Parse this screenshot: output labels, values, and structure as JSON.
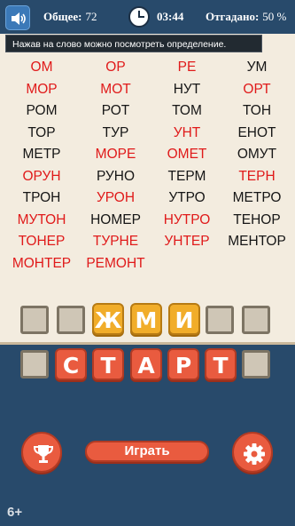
{
  "header": {
    "total_label": "Общее:",
    "total_value": "72",
    "timer": "03:44",
    "guessed_label": "Отгадано:",
    "guessed_value": "50 %",
    "sound_icon": "speaker-icon",
    "clock_icon": "clock-icon"
  },
  "hint": "Нажав на слово можно посмотреть определение.",
  "words": [
    {
      "text": "ОМ",
      "found": true
    },
    {
      "text": "ОР",
      "found": true
    },
    {
      "text": "РЕ",
      "found": true
    },
    {
      "text": "УМ",
      "found": false
    },
    {
      "text": "МОР",
      "found": true
    },
    {
      "text": "МОТ",
      "found": true
    },
    {
      "text": "НУТ",
      "found": false
    },
    {
      "text": "ОРТ",
      "found": true
    },
    {
      "text": "РОМ",
      "found": false
    },
    {
      "text": "РОТ",
      "found": false
    },
    {
      "text": "ТОМ",
      "found": false
    },
    {
      "text": "ТОН",
      "found": false
    },
    {
      "text": "ТОР",
      "found": false
    },
    {
      "text": "ТУР",
      "found": false
    },
    {
      "text": "УНТ",
      "found": true
    },
    {
      "text": "ЕНОТ",
      "found": false
    },
    {
      "text": "МЕТР",
      "found": false
    },
    {
      "text": "МОРЕ",
      "found": true
    },
    {
      "text": "ОМЕТ",
      "found": true
    },
    {
      "text": "ОМУТ",
      "found": false
    },
    {
      "text": "ОРУН",
      "found": true
    },
    {
      "text": "РУНО",
      "found": false
    },
    {
      "text": "ТЕРМ",
      "found": false
    },
    {
      "text": "ТЕРН",
      "found": true
    },
    {
      "text": "ТРОН",
      "found": false
    },
    {
      "text": "УРОН",
      "found": true
    },
    {
      "text": "УТРО",
      "found": false
    },
    {
      "text": "МЕТРО",
      "found": false
    },
    {
      "text": "МУТОН",
      "found": true
    },
    {
      "text": "НОМЕР",
      "found": false
    },
    {
      "text": "НУТРО",
      "found": true
    },
    {
      "text": "ТЕНОР",
      "found": false
    },
    {
      "text": "ТОНЕР",
      "found": true
    },
    {
      "text": "ТУРНЕ",
      "found": true
    },
    {
      "text": "УНТЕР",
      "found": true
    },
    {
      "text": "МЕНТОР",
      "found": false
    },
    {
      "text": "МОНТЕР",
      "found": true
    },
    {
      "text": "РЕМОНТ",
      "found": true
    }
  ],
  "input_letters": [
    "Ж",
    "М",
    "И"
  ],
  "source_letters": [
    "С",
    "Т",
    "А",
    "Р",
    "Т"
  ],
  "buttons": {
    "play_label": "Играть",
    "trophy_icon": "trophy-icon",
    "settings_icon": "gear-icon"
  },
  "age_rating": "6+",
  "colors": {
    "found_word": "#e01a1a",
    "panel": "#284a6b",
    "tile_yellow": "#f1ad2a",
    "tile_red": "#e95b3f"
  }
}
